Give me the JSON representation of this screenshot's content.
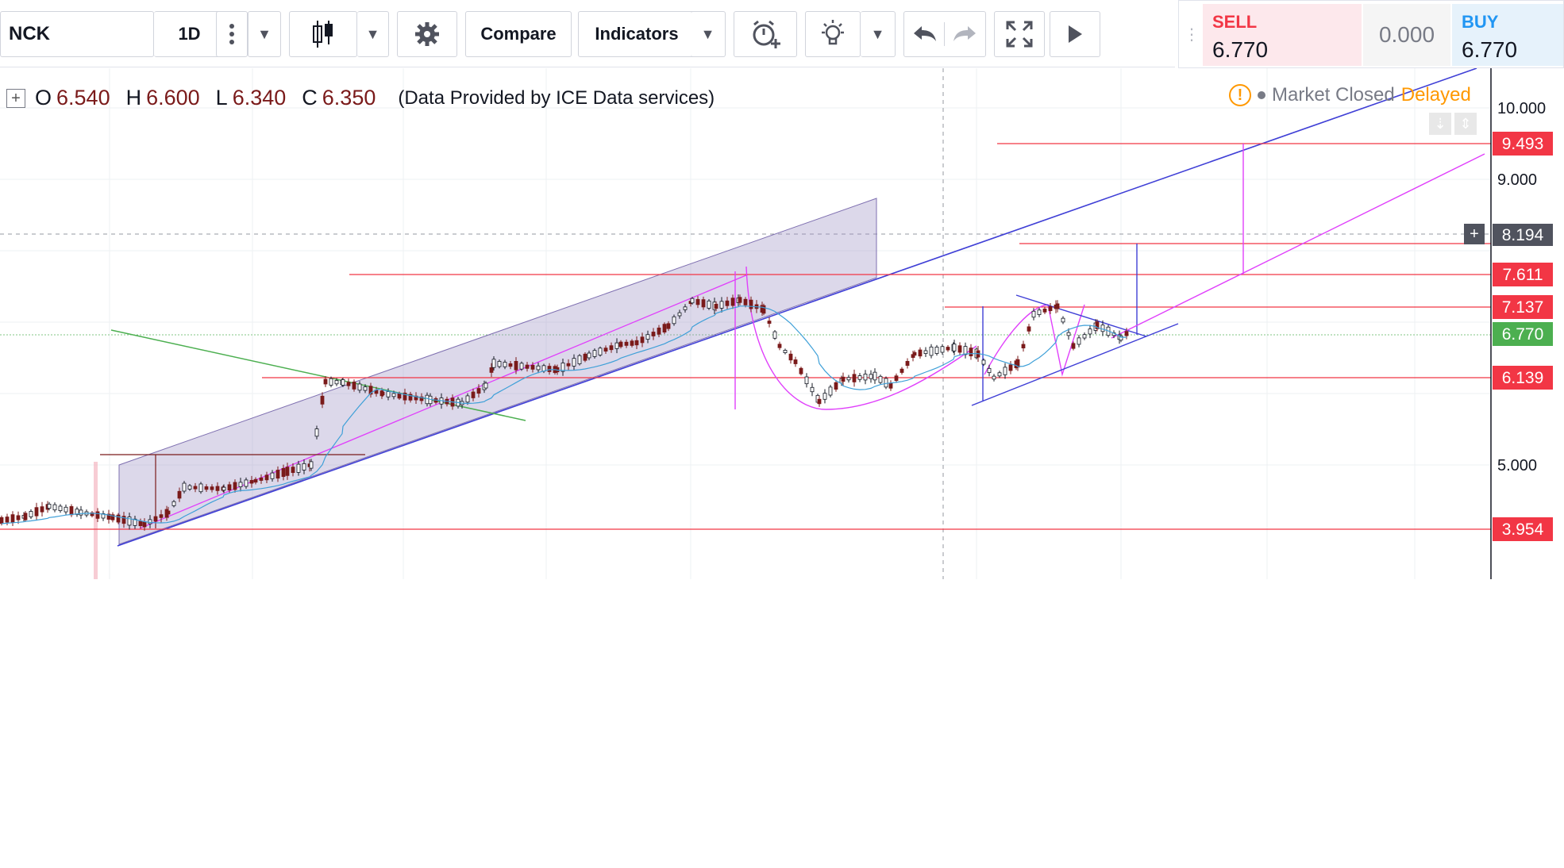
{
  "toolbar": {
    "symbol": "NCK",
    "interval": "1D",
    "compare": "Compare",
    "indicators": "Indicators",
    "icons": [
      "more-vert-icon",
      "caret-down-icon",
      "candles-icon",
      "gear-icon",
      "alert-clock-icon",
      "lightbulb-icon",
      "undo-icon",
      "redo-icon",
      "fullscreen-icon",
      "play-icon"
    ]
  },
  "trade": {
    "sell_label": "SELL",
    "sell_value": "6.770",
    "spread": "0.000",
    "buy_label": "BUY",
    "buy_value": "6.770",
    "colors": {
      "sell": "#f23645",
      "buy": "#2196f3"
    }
  },
  "legend": {
    "o_key": "O",
    "o_val": "6.540",
    "h_key": "H",
    "h_val": "6.600",
    "l_key": "L",
    "l_val": "6.340",
    "c_key": "C",
    "c_val": "6.350",
    "source": "(Data Provided by ICE Data services)"
  },
  "status": {
    "closed": "Market Closed",
    "delayed": "Delayed"
  },
  "axis": {
    "ticks": [
      "10.000",
      "9.000",
      "5.000"
    ],
    "tags": [
      {
        "value": "9.493",
        "color": "#f23645"
      },
      {
        "value": "8.194",
        "color": "#50535e"
      },
      {
        "value": "7.611",
        "color": "#f23645"
      },
      {
        "value": "7.137",
        "color": "#f23645"
      },
      {
        "value": "6.770",
        "color": "#4caf50"
      },
      {
        "value": "6.139",
        "color": "#f23645"
      },
      {
        "value": "3.954",
        "color": "#f23645"
      }
    ]
  }
}
